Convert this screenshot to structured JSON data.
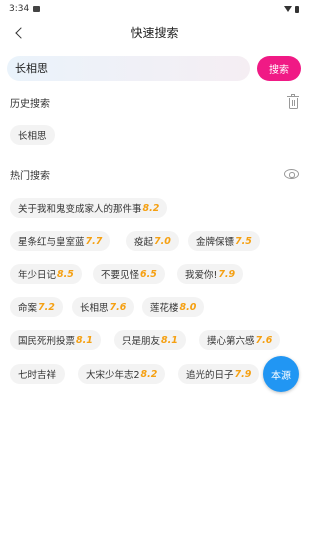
{
  "status_bar": {
    "time": "3:34"
  },
  "nav": {
    "title": "快速搜索"
  },
  "search": {
    "value": "长相思",
    "button_label": "搜索"
  },
  "history": {
    "title": "历史搜索",
    "items": [
      "长相思"
    ]
  },
  "hot": {
    "title": "热门搜索",
    "items": [
      {
        "name": "关于我和鬼变成家人的那件事",
        "score": "8.2"
      },
      {
        "name": "星条红与皇室蓝",
        "score": "7.7"
      },
      {
        "name": "疫起",
        "score": "7.0"
      },
      {
        "name": "金牌保镖",
        "score": "7.5"
      },
      {
        "name": "年少日记",
        "score": "8.5"
      },
      {
        "name": "不要见怪",
        "score": "6.5"
      },
      {
        "name": "我爱你!",
        "score": "7.9"
      },
      {
        "name": "命案",
        "score": "7.2"
      },
      {
        "name": "长相思",
        "score": "7.6"
      },
      {
        "name": "莲花楼",
        "score": "8.0"
      },
      {
        "name": "国民死刑投票",
        "score": "8.1"
      },
      {
        "name": "只是朋友",
        "score": "8.1"
      },
      {
        "name": "摸心第六感",
        "score": "7.6"
      },
      {
        "name": "七时吉祥",
        "score": ""
      },
      {
        "name": "大宋少年志2",
        "score": "8.2"
      },
      {
        "name": "追光的日子",
        "score": "7.9"
      }
    ]
  },
  "fab": {
    "label": "本源"
  },
  "colors": {
    "accent": "#f01a85",
    "score": "#f5a012",
    "fab": "#2196f3"
  }
}
